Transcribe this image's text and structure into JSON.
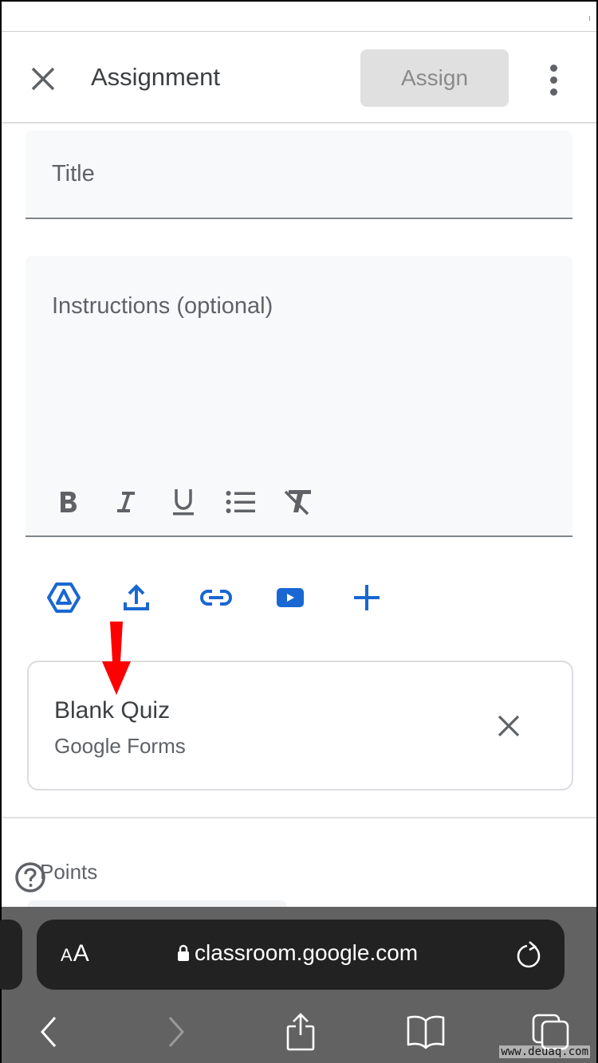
{
  "appbar": {
    "title": "Assignment",
    "assign_label": "Assign",
    "close_icon": "close-icon",
    "more_icon": "more-vert-icon"
  },
  "form": {
    "title_placeholder": "Title",
    "instructions_placeholder": "Instructions (optional)",
    "format_tools": [
      {
        "name": "bold",
        "icon": "bold-icon"
      },
      {
        "name": "italic",
        "icon": "italic-icon"
      },
      {
        "name": "underline",
        "icon": "underline-icon"
      },
      {
        "name": "bulleted-list",
        "icon": "bulleted-list-icon"
      },
      {
        "name": "clear-formatting",
        "icon": "clear-formatting-icon"
      }
    ],
    "attach_tools": [
      {
        "name": "google-drive",
        "icon": "google-drive-icon"
      },
      {
        "name": "upload",
        "icon": "upload-icon"
      },
      {
        "name": "link",
        "icon": "link-icon"
      },
      {
        "name": "youtube",
        "icon": "youtube-icon"
      },
      {
        "name": "create",
        "icon": "plus-icon"
      }
    ],
    "accent_color": "#1967d2"
  },
  "attachment": {
    "title": "Blank Quiz",
    "subtitle": "Google Forms"
  },
  "points": {
    "label": "Points"
  },
  "annotation": {
    "arrow_color": "#ff0000"
  },
  "browser": {
    "text_size_label_small": "A",
    "text_size_label_large": "A",
    "url": "classroom.google.com"
  },
  "watermark": "www.deuaq.com"
}
